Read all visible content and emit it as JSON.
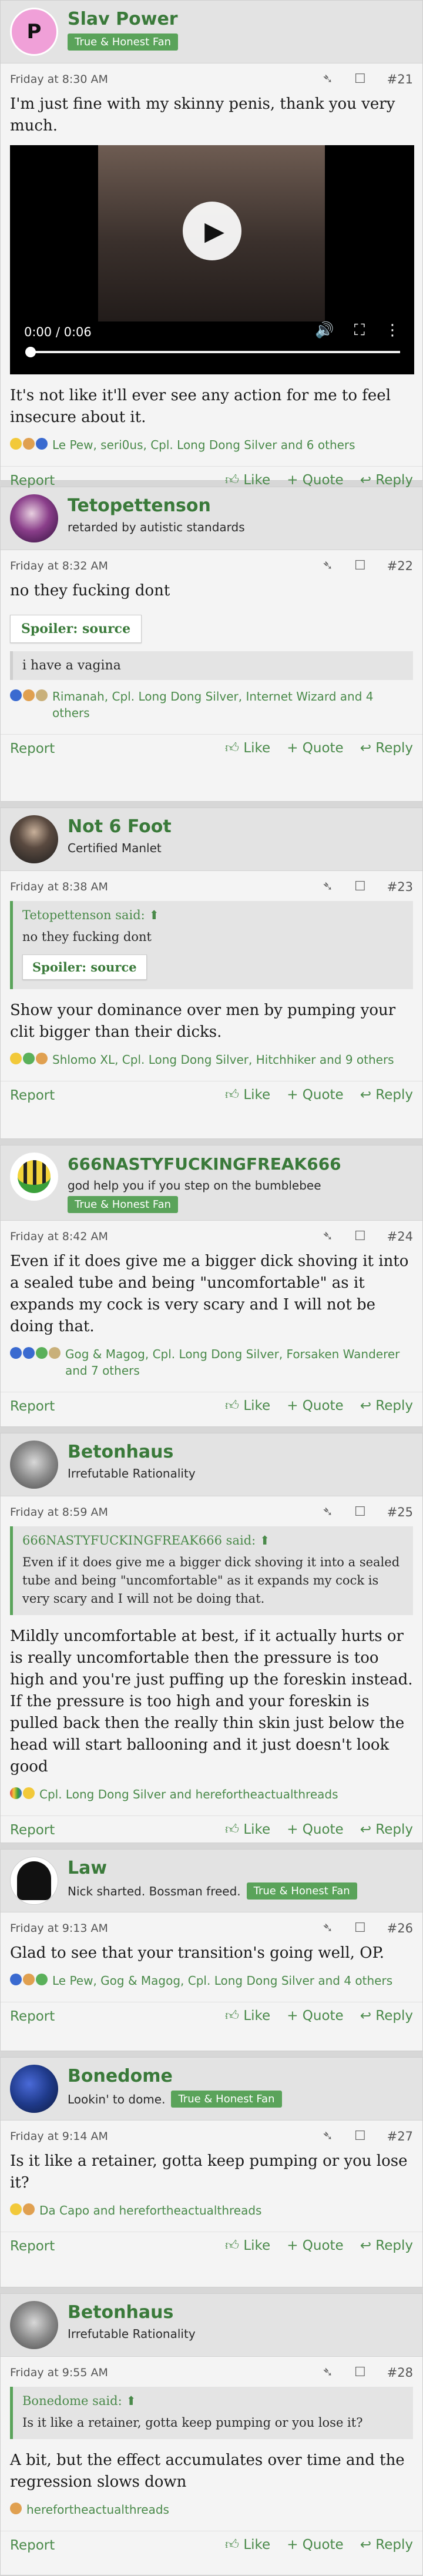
{
  "colors": {
    "accent": "#5aa35a",
    "link": "#4a8a4a",
    "username": "#3a7a3a"
  },
  "footer": {
    "report": "Report",
    "like": "Like",
    "quote": "Quote",
    "reply": "Reply",
    "like_icon": "thumbs-up-icon",
    "quote_icon": "plus-icon",
    "reply_icon": "reply-icon"
  },
  "posts": [
    {
      "avatar_letter": "P",
      "avatar_color": "#e04fb0",
      "username": "Slav Power",
      "title": "",
      "badge": "True & Honest Fan",
      "date": "Friday at 8:30 AM",
      "number": "#21",
      "text1": "I'm just fine with my skinny penis, thank you very much.",
      "video": {
        "time": "0:00 / 0:06",
        "progress": 0.0
      },
      "text2": "It's not like it'll ever see any action for me to feel insecure about it.",
      "reactions": "Le Pew, seri0us, Cpl. Long Dong Silver and 6 others"
    },
    {
      "avatar_letter": "",
      "avatar_color": "#5b2a6e",
      "username": "Tetopettenson",
      "title": "retarded by autistic standards",
      "date": "Friday at 8:32 AM",
      "number": "#22",
      "text1": "no they fucking dont",
      "spoiler_label": "Spoiler: source",
      "spoiler_content": "i have a vagina",
      "reactions": "Rimanah, Cpl. Long Dong Silver, Internet Wizard and 4 others"
    },
    {
      "avatar_letter": "",
      "avatar_color": "#3f3f3f",
      "username": "Not 6 Foot",
      "title": "Certified Manlet",
      "date": "Friday at 8:38 AM",
      "number": "#23",
      "quote_author": "Tetopettenson said:",
      "quote_text": "no they fucking dont",
      "quote_spoiler": "Spoiler: source",
      "text1": "Show your dominance over men by pumping your clit bigger than their dicks.",
      "reactions": "Shlomo XL, Cpl. Long Dong Silver, Hitchhiker and 9 others"
    },
    {
      "avatar_letter": "",
      "avatar_color": "#f2d33a",
      "username": "666NASTYFUCKINGFREAK666",
      "title": "god help you if you step on the bumblebee",
      "badge": "True & Honest Fan",
      "date": "Friday at 8:42 AM",
      "number": "#24",
      "text1": "Even if it does give me a bigger dick shoving it into a sealed tube and being \"uncomfortable\" as it expands my cock is very scary and I will not be doing that.",
      "reactions": "Gog & Magog, Cpl. Long Dong Silver, Forsaken Wanderer and 7 others"
    },
    {
      "avatar_letter": "",
      "avatar_color": "#9a9a9a",
      "username": "Betonhaus",
      "title": "Irrefutable Rationality",
      "date": "Friday at 8:59 AM",
      "number": "#25",
      "quote_author": "666NASTYFUCKINGFREAK666 said:",
      "quote_text": "Even if it does give me a bigger dick shoving it into a sealed tube and being \"uncomfortable\" as it expands my cock is very scary and I will not be doing that.",
      "text1": "Mildly uncomfortable at best, if it actually hurts or is really uncomfortable then the pressure is too high and you're just puffing up the foreskin instead. If the pressure is too high and your foreskin is pulled back then the really thin skin just below the head will start ballooning and it just doesn't look good",
      "reactions": "Cpl. Long Dong Silver and herefortheactualthreads"
    },
    {
      "avatar_letter": "",
      "avatar_color": "#ffffff",
      "username": "Law",
      "title": "Nick sharted. Bossman freed.",
      "badge": "True & Honest Fan",
      "date": "Friday at 9:13 AM",
      "number": "#26",
      "text1": "Glad to see that your transition's going well, OP.",
      "reactions": "Le Pew, Gog & Magog, Cpl. Long Dong Silver and 4 others"
    },
    {
      "avatar_letter": "",
      "avatar_color": "#1f3a8a",
      "username": "Bonedome",
      "title": "Lookin' to dome.",
      "badge": "True & Honest Fan",
      "date": "Friday at 9:14 AM",
      "number": "#27",
      "text1": "Is it like a retainer, gotta keep pumping or you lose it?",
      "reactions": "Da Capo and herefortheactualthreads"
    },
    {
      "avatar_letter": "",
      "avatar_color": "#9a9a9a",
      "username": "Betonhaus",
      "title": "Irrefutable Rationality",
      "date": "Friday at 9:55 AM",
      "number": "#28",
      "quote_author": "Bonedome said:",
      "quote_text": "Is it like a retainer, gotta keep pumping or you lose it?",
      "text1": "A bit, but the effect accumulates over time and the regression slows down",
      "reactions": "herefortheactualthreads"
    }
  ]
}
